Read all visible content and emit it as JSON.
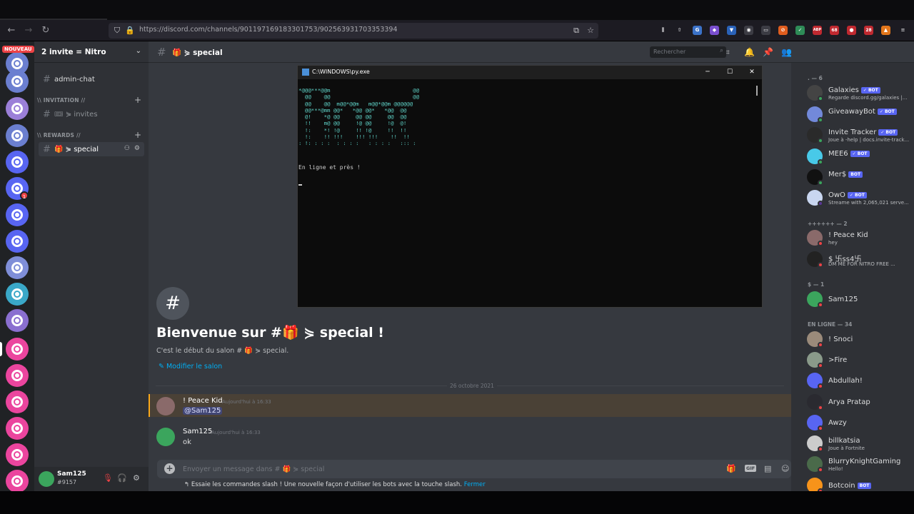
{
  "browser": {
    "url": "https://discord.com/channels/901197169183301753/902563931703353394",
    "extension_badges": [
      "ABP",
      "68",
      "28"
    ]
  },
  "guilds": {
    "new_badge": "NOUVEAU",
    "mention_count": "1"
  },
  "server": {
    "name": "2 invite = Nitro",
    "channels": [
      {
        "label": "admin-chat"
      },
      {
        "category": "\\\\ INVITATION //"
      },
      {
        "label": "🎟 ⋟ invites"
      },
      {
        "category": "\\\\ REWARDS //"
      },
      {
        "label": "🎁 ⋟ special",
        "active": true
      }
    ]
  },
  "user": {
    "name": "Sam125",
    "tag": "#9157"
  },
  "channel": {
    "title": "🎁 ⋟ special",
    "search_placeholder": "Rechercher",
    "welcome_title": "Bienvenue sur #🎁 ⋟ special !",
    "welcome_sub": "C'est le début du salon # 🎁 ⋟ special.",
    "edit_link": "Modifier le salon",
    "date_divider": "26 octobre 2021",
    "composer_placeholder": "Envoyer un message dans # 🎁 ⋟ special",
    "tip_text": "Essaie les commandes slash ! Une nouvelle façon d'utiliser les bots avec la touche slash.",
    "tip_link": "Fermer"
  },
  "messages": [
    {
      "author": "! Peace Kid",
      "time": "Aujourd'hui à 16:33",
      "text": "@Sam125",
      "highlight": true
    },
    {
      "author": "Sam125",
      "time": "Aujourd'hui à 16:33",
      "text": "ok"
    }
  ],
  "console": {
    "title": "C:\\WINDOWS\\py.exe",
    "ascii_art": "*@@@***@@m                          @@\n  @@    @@                          @@\n  @@    @@  m@@*@@m   m@@*@@m @@@@@@\n  @@***@mm @@*   *@@ @@*   *@@  @@\n  @!    *@ @@     @@ @@     @@  @@\n  !!    m@ @@     !@ @@     !@  @!\n  !:    *! !@     !! !@     !!  !!\n  !:    !! !!!    !!! !!!    !!  !!\n: !: : : :  : : : :   : : : :   ::: :",
    "status": "En ligne et près !"
  },
  "members": {
    "categories": [
      ". — 6",
      "++++++ — 2",
      "$ — 1",
      "EN LIGNE — 34"
    ],
    "list": [
      {
        "name": "Galaxies",
        "bot": "✓ BOT",
        "status": "Regarde discord.gg/galaxies |..."
      },
      {
        "name": "GiveawayBot",
        "bot": "✓ BOT",
        "status": ""
      },
      {
        "name": "Invite Tracker",
        "bot": "✓ BOT",
        "status": "Joue à -help | docs.invite-track..."
      },
      {
        "name": "MEE6",
        "bot": "✓ BOT",
        "status": ""
      },
      {
        "name": "Mer$",
        "bot": "BOT",
        "status": ""
      },
      {
        "name": "OwO",
        "bot": "✓ BOT",
        "status": "Streame with 2,065,021 serve..."
      },
      {
        "name": "! Peace Kid",
        "bot": "",
        "status": "hey"
      },
      {
        "name": "$ 卐ss4卐",
        "bot": "",
        "status": "DM ME FOR NITRO FREE ..."
      },
      {
        "name": "Sam125",
        "bot": "",
        "status": ""
      },
      {
        "name": "! Snoci",
        "bot": "",
        "status": ""
      },
      {
        "name": ">Fire",
        "bot": "",
        "status": ""
      },
      {
        "name": "Abdullah!",
        "bot": "",
        "status": ""
      },
      {
        "name": "Arya Pratap",
        "bot": "",
        "status": ""
      },
      {
        "name": "Awzy",
        "bot": "",
        "status": ""
      },
      {
        "name": "billkatsia",
        "bot": "",
        "status": "Joue à Fortnite"
      },
      {
        "name": "BlurryKnightGaming",
        "bot": "",
        "status": "Hello!"
      },
      {
        "name": "Botcoin",
        "bot": "BOT",
        "status": ""
      }
    ]
  },
  "colors": {
    "blurple": "#5865f2",
    "online": "#3ba55d",
    "dnd": "#ed4245",
    "mention_bg": "#4a4136",
    "console_text": "#5fd3c8"
  }
}
